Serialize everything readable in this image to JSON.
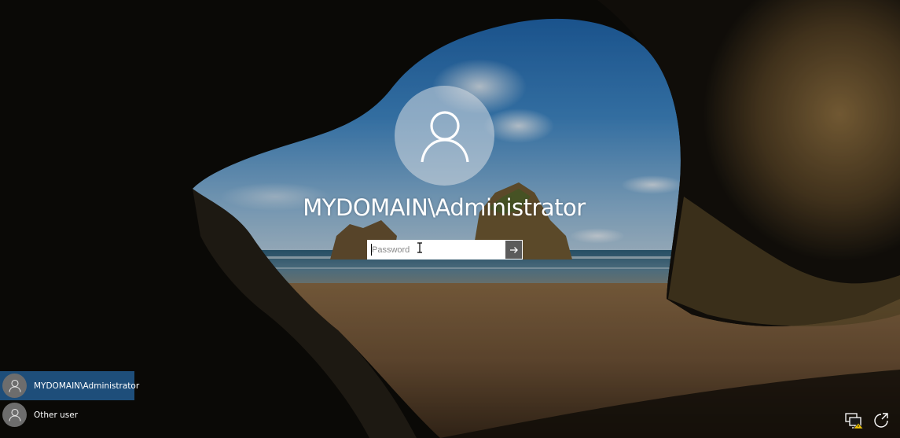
{
  "lock_screen": {
    "username": "MYDOMAIN\\Administrator",
    "password_placeholder": "Password",
    "password_value": ""
  },
  "user_list": [
    {
      "label": "MYDOMAIN\\Administrator",
      "selected": true
    },
    {
      "label": "Other user",
      "selected": false
    }
  ],
  "icons": {
    "avatar": "user-silhouette-icon",
    "submit": "arrow-right-icon",
    "network": "network-icon",
    "ease_of_access": "ease-of-access-icon",
    "power": "power-icon"
  },
  "colors": {
    "selected_user_bg": "#1e4e7a",
    "submit_button_bg": "#5b5b5b",
    "avatar_circle": "#d7dce2"
  }
}
